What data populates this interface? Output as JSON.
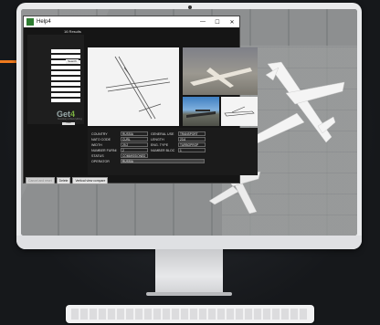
{
  "window": {
    "title": "Help4",
    "minimize_glyph": "—",
    "maximize_glyph": "☐",
    "close_glyph": "✕"
  },
  "results": {
    "count_label": "16 Results"
  },
  "search_panel": {
    "search_label": "Search"
  },
  "brand": {
    "main": "Get",
    "digit": "4",
    "tagline": "Inventory of Everything",
    "reset_label": "Reset"
  },
  "details": {
    "country_label": "COUNTRY",
    "country_value": "RUSSIA",
    "general_use_label": "GENERAL USE",
    "general_use_value": "TRANSPORT",
    "nato_code_label": "NATO CODE",
    "nato_code_value": "CURL",
    "length_label": "LENGTH",
    "length_value": "23.6",
    "width_label": "WIDTH",
    "width_value": "29.2",
    "eng_type_label": "ENG. TYPE",
    "eng_type_value": "TURBOPROP",
    "number_furnished_label": "NUMBER FURNI",
    "number_furnished_value": "2",
    "number_block_label": "NUMBER BLOC",
    "number_block_value": "1",
    "status_label": "STATUS",
    "status_value": "COMMISSIONED",
    "operator_label": "OPERATOR",
    "operator_value": "RUSSIA"
  },
  "buttons": {
    "cancel_label": "Cancel and reset",
    "delete_label": "Delete",
    "vertical_compare_label": "Vertical view compare"
  }
}
